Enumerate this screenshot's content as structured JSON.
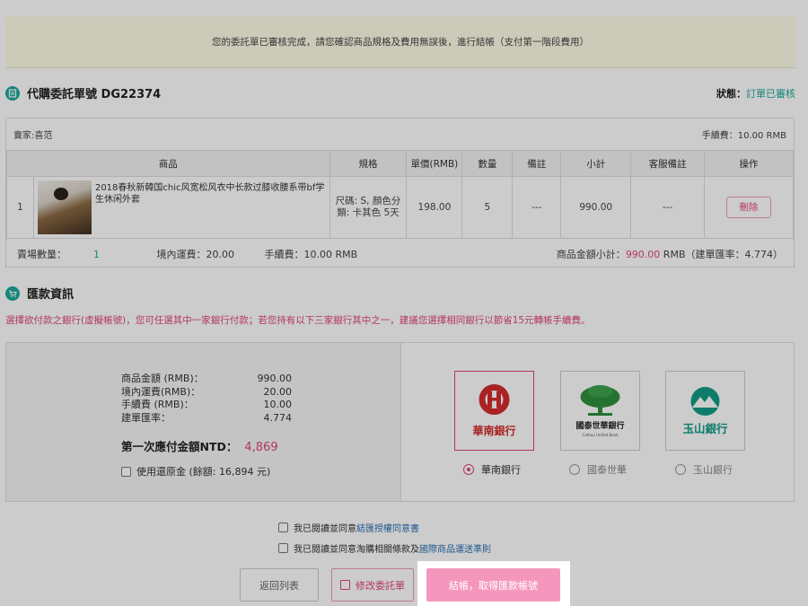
{
  "notice": "您的委託單已審核完成，請您確認商品規格及費用無誤後，進行結帳（支付第一階段費用）",
  "order": {
    "title": "代購委託單號 DG22374",
    "status_label": "狀態：",
    "status_value": "訂單已審核",
    "seller": "賣家:喜范",
    "fee_top": "手續費：10.00 RMB",
    "headers": [
      "商品",
      "規格",
      "單價(RMB)",
      "數量",
      "備註",
      "小計",
      "客服備註",
      "操作"
    ],
    "items": [
      {
        "index": "1",
        "name": "2018春秋新韓国chic风宽松风衣中长款过膝收腰系带bf学生休闲外套",
        "spec": "尺碼: S, 顏色分類: 卡其色 5天",
        "price": "198.00",
        "qty": "5",
        "remark": "---",
        "subtotal": "990.00",
        "cs_remark": "---",
        "action": "刪除"
      }
    ],
    "footer": {
      "qty_label": "賣場數量：",
      "qty_value": "1",
      "shipping": "境內運費：20.00",
      "fee": "手續費：10.00 RMB",
      "subtotal_label": "商品金額小計：",
      "subtotal_value": "990.00",
      "subtotal_unit": " RMB",
      "rate": "（建單匯率：4.774）"
    }
  },
  "payment": {
    "title": "匯款資訊",
    "note": "選擇欲付款之銀行(虛擬帳號)，您可任選其中一家銀行付款；若您持有以下三家銀行其中之一，建議您選擇相同銀行以節省15元轉帳手續費。",
    "amounts": [
      {
        "label": "商品金額 (RMB)：",
        "value": "990.00"
      },
      {
        "label": "境內運費(RMB)：",
        "value": "20.00"
      },
      {
        "label": "手續費 (RMB)：",
        "value": "10.00"
      },
      {
        "label": "建單匯率：",
        "value": "4.774"
      }
    ],
    "first_pay_label": "第一次應付金額NTD：",
    "first_pay_value": "4,869",
    "balance_label": "使用還原金 (餘額: 16,894 元)",
    "banks": [
      {
        "name": "華南銀行",
        "logo_text": "華南銀行",
        "selected": true
      },
      {
        "name": "國泰世華",
        "logo_text": "國泰世華銀行",
        "logo_sub": "Cathay United Bank",
        "selected": false
      },
      {
        "name": "玉山銀行",
        "logo_text": "玉山銀行",
        "selected": false
      }
    ]
  },
  "agreements": {
    "a1_text": "我已閱讀並同意",
    "a1_link": "結匯授權同意書",
    "a2_text": "我已閱讀並同意淘購相關條款及",
    "a2_link": "國際商品運送準則"
  },
  "buttons": {
    "back": "返回列表",
    "edit": "修改委託單",
    "checkout": "結帳，取得匯款帳號"
  },
  "colors": {
    "accent": "#1fa89c",
    "pink": "#e0457a",
    "checkout": "#f597bd"
  }
}
